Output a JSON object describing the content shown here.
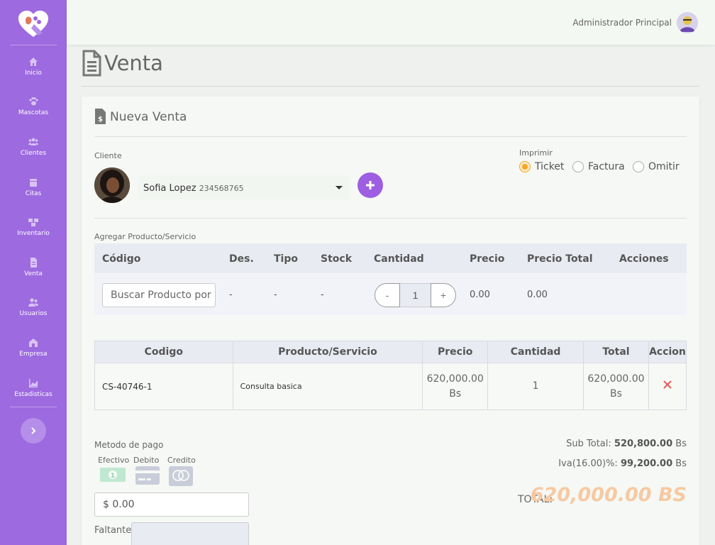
{
  "sidebar": {
    "items": [
      {
        "label": "Inicio",
        "icon": "home-icon"
      },
      {
        "label": "Mascotas",
        "icon": "paw-icon"
      },
      {
        "label": "Clientes",
        "icon": "users-icon"
      },
      {
        "label": "Citas",
        "icon": "calendar-icon"
      },
      {
        "label": "Inventario",
        "icon": "boxes-icon"
      },
      {
        "label": "Venta",
        "icon": "invoice-icon"
      },
      {
        "label": "Usuarios",
        "icon": "user-group-icon"
      },
      {
        "label": "Empresa",
        "icon": "building-icon"
      },
      {
        "label": "Estadisticas",
        "icon": "chart-icon"
      }
    ],
    "accent": "#9d6ae0"
  },
  "topbar": {
    "user_name": "Administrador Principal"
  },
  "page": {
    "title": "Venta"
  },
  "card": {
    "title": "Nueva Venta",
    "client_label": "Cliente",
    "client_name": "Sofia Lopez",
    "client_ci": "234568765",
    "print_label": "Imprimir",
    "print_options": [
      "Ticket",
      "Factura",
      "Omitir"
    ],
    "print_selected": "Ticket",
    "add_label": "Agregar Producto/Servicio"
  },
  "product_table": {
    "headers": [
      "Código",
      "Des.",
      "Tipo",
      "Stock",
      "Cantidad",
      "Precio",
      "Precio Total",
      "Acciones"
    ],
    "search_placeholder": "Buscar Producto por",
    "des": "-",
    "tipo": "-",
    "stock": "-",
    "quantity": "1",
    "minus": "-",
    "plus": "+",
    "precio": "0.00",
    "precio_total": "0.00"
  },
  "items_table": {
    "headers": [
      "Codigo",
      "Producto/Servicio",
      "Precio",
      "Cantidad",
      "Total",
      "Accion"
    ],
    "rows": [
      {
        "codigo": "CS-40746-1",
        "producto": "Consulta basica",
        "precio": "620,000.00",
        "precio_unit": "Bs",
        "cantidad": "1",
        "total": "620,000.00",
        "total_unit": "Bs"
      }
    ]
  },
  "payment": {
    "label": "Metodo de pago",
    "methods": [
      "Efectivo",
      "Debito",
      "Credito"
    ],
    "cash_value": "$ 0.00",
    "faltante_label": "Faltante:"
  },
  "totals": {
    "subtotal_label": "Sub Total:",
    "subtotal_value": "520,800.00",
    "iva_label": "Iva(16.00)%:",
    "iva_value": "99,200.00",
    "currency": "Bs",
    "total_label": "TOTAL:",
    "total_value": "620,000.00 BS"
  }
}
